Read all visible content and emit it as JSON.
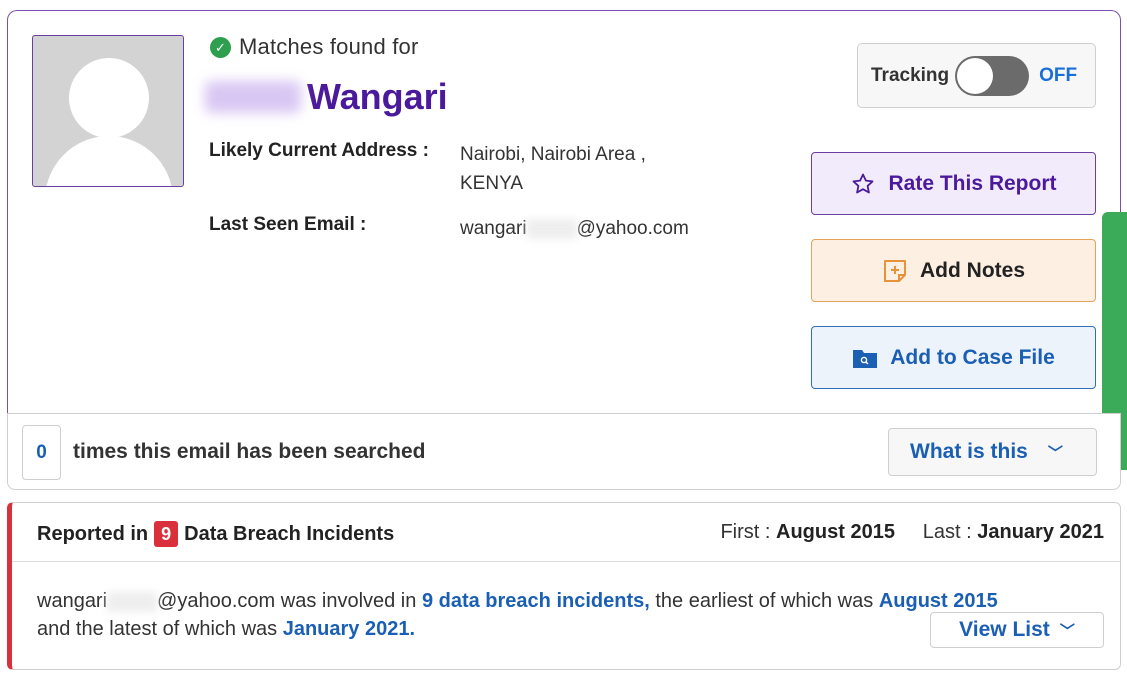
{
  "profile": {
    "match_text": "Matches found for",
    "name": "Wangari",
    "address_label": "Likely Current Address :",
    "address_line1": "Nairobi, Nairobi Area ,",
    "address_line2": "KENYA",
    "email_label": "Last Seen Email :",
    "email_prefix": "wangari",
    "email_suffix": "@yahoo.com"
  },
  "tracking": {
    "label": "Tracking",
    "state": "OFF"
  },
  "actions": {
    "rate_label": "Rate This Report",
    "notes_label": "Add Notes",
    "case_label": "Add to Case File"
  },
  "search": {
    "count": "0",
    "text": "times this email has been searched",
    "what_label": "What is this"
  },
  "breach": {
    "title_prefix": "Reported in",
    "count": "9",
    "title_suffix": "Data Breach Incidents",
    "first_label": "First :",
    "first_value": "August 2015",
    "last_label": "Last :",
    "last_value": "January 2021",
    "email_prefix": "wangari",
    "email_suffix": "@yahoo.com",
    "sentence_a": "was involved in",
    "incidents_link": "9 data breach incidents,",
    "sentence_b": "the earliest of which was",
    "earliest_link": "August 2015",
    "sentence_c": "and the latest of which was",
    "latest_link": "January 2021.",
    "view_list_label": "View List"
  },
  "colors": {
    "brand_purple": "#4b1a9c",
    "link_blue": "#1a5fb4",
    "breach_red": "#d9303b",
    "success_green": "#2e9e4f"
  }
}
